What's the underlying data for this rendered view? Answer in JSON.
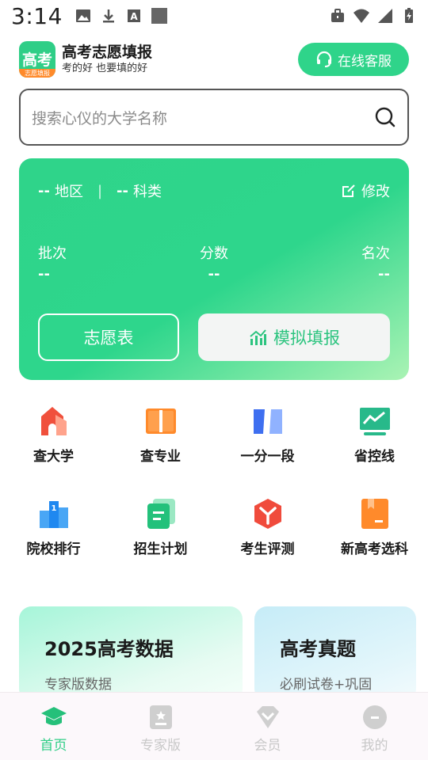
{
  "status_bar": {
    "time": "3:14",
    "left_icons": [
      "image-icon",
      "download-icon",
      "font-icon",
      "square-icon"
    ],
    "right_icons": [
      "briefcase-icon",
      "wifi-icon",
      "signal-icon",
      "battery-charging-icon"
    ]
  },
  "header": {
    "logo_main": "高考",
    "logo_sub": "志愿填报",
    "title": "高考志愿填报",
    "slogan": "考的好 也要填的好",
    "service_label": "在线客服",
    "service_icon": "headset-icon"
  },
  "search": {
    "placeholder": "搜索心仪的大学名称",
    "icon": "search-icon"
  },
  "score_card": {
    "region_value": "--",
    "region_label": "地区",
    "divider": "|",
    "subject_value": "--",
    "subject_label": "科类",
    "edit_label": "修改",
    "stats": [
      {
        "label": "批次",
        "value": "--"
      },
      {
        "label": "分数",
        "value": "--"
      },
      {
        "label": "名次",
        "value": "--"
      }
    ],
    "wish_table_label": "志愿表",
    "simulate_label": "模拟填报",
    "accent": "#2fd48a"
  },
  "grid": [
    {
      "label": "查大学",
      "icon": "university-icon"
    },
    {
      "label": "查专业",
      "icon": "book-icon"
    },
    {
      "label": "一分一段",
      "icon": "score-segment-icon"
    },
    {
      "label": "省控线",
      "icon": "line-chart-icon"
    },
    {
      "label": "院校排行",
      "icon": "ranking-icon"
    },
    {
      "label": "招生计划",
      "icon": "plan-doc-icon"
    },
    {
      "label": "考生评测",
      "icon": "evaluation-icon"
    },
    {
      "label": "新高考选科",
      "icon": "subject-select-icon"
    }
  ],
  "promos": [
    {
      "title": "2025高考数据",
      "subtitle": "专家版数据"
    },
    {
      "title": "高考真题",
      "subtitle": "必刷试卷+巩固"
    }
  ],
  "bottom_nav": [
    {
      "label": "首页",
      "icon": "graduation-cap-icon",
      "active": true
    },
    {
      "label": "专家版",
      "icon": "expert-doc-icon",
      "active": false
    },
    {
      "label": "会员",
      "icon": "vip-diamond-icon",
      "active": false
    },
    {
      "label": "我的",
      "icon": "profile-icon",
      "active": false
    }
  ]
}
